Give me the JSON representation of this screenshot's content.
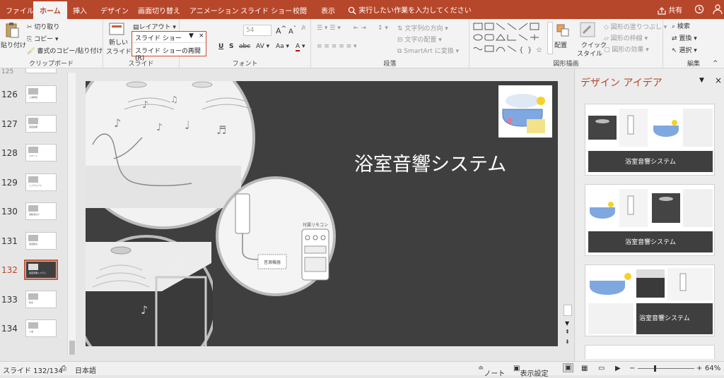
{
  "tabs": [
    "ファイル",
    "ホーム",
    "挿入",
    "デザイン",
    "画面切り替え",
    "アニメーション",
    "スライド ショー",
    "校閲",
    "表示"
  ],
  "active_tab": "ホーム",
  "tell_me": "実行したい作業を入力してください",
  "share": "共有",
  "ribbon": {
    "clipboard": {
      "paste": "貼り付け",
      "cut": "切り取り",
      "copy": "コピー",
      "format_painter": "書式のコピー/貼り付け",
      "label": "クリップボード"
    },
    "slides": {
      "new_slide_1": "新しい",
      "new_slide_2": "スライド",
      "layout": "レイアウト",
      "label": "スライド"
    },
    "font": {
      "size": "54",
      "label": "フォント"
    },
    "paragraph": {
      "text_direction": "文字列の方向",
      "align_text": "文字の配置",
      "smartart": "SmartArt に変換",
      "label": "段落"
    },
    "drawing": {
      "arrange": "配置",
      "quick_styles_1": "クイック",
      "quick_styles_2": "スタイル",
      "shape_fill": "図形の塗りつぶし",
      "shape_outline": "図形の枠線",
      "shape_effects": "図形の効果",
      "label": "図形描画"
    },
    "editing": {
      "find": "検索",
      "replace": "置換",
      "select": "選択",
      "label": "編集"
    }
  },
  "dropdown": {
    "item1": "スライド ショー",
    "item2": "スライド ショーの再開(R)"
  },
  "thumbnails": [
    {
      "num": "126",
      "label": "入浴時間"
    },
    {
      "num": "127",
      "label": "浴室設備"
    },
    {
      "num": "128",
      "label": "スマート"
    },
    {
      "num": "129",
      "label": "システムバス"
    },
    {
      "num": "130",
      "label": "自動湯はり"
    },
    {
      "num": "131",
      "label": "浴室暖房"
    },
    {
      "num": "132",
      "label": "浴室音響システム"
    },
    {
      "num": "133",
      "label": "防水"
    },
    {
      "num": "134",
      "label": "入浴"
    }
  ],
  "first_num_partial": "125",
  "selected_index": 6,
  "slide": {
    "title": "浴室音響システム",
    "remote_label": "付属リモコン",
    "device_label": "音源機器"
  },
  "design_pane": {
    "title": "デザイン アイデア",
    "card_title": "浴室音響システム"
  },
  "status": {
    "slide_count": "スライド 132/134",
    "language": "日本語",
    "notes": "ノート",
    "display_settings": "表示設定",
    "zoom": "64%"
  },
  "colors": {
    "accent": "#b7472a",
    "slide_bg": "#3f3f3f"
  }
}
